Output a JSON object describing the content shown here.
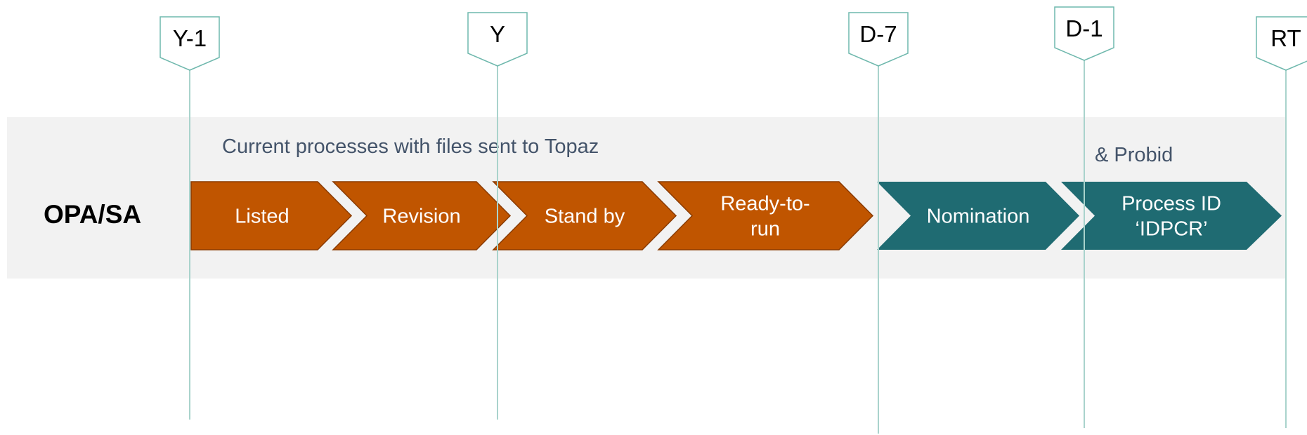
{
  "colors": {
    "band": "#f2f2f2",
    "orange": "#c05500",
    "orange_stroke": "#8a3b00",
    "teal": "#1f6b72",
    "marker_line": "#a9d3cc",
    "marker_box_stroke": "#6fb8ad",
    "caption_text": "#44546a"
  },
  "markers": [
    {
      "id": "y-minus-1",
      "label": "Y-1"
    },
    {
      "id": "y",
      "label": "Y"
    },
    {
      "id": "d-minus-7",
      "label": "D-7"
    },
    {
      "id": "d-minus-1",
      "label": "D-1"
    },
    {
      "id": "rt",
      "label": "RT"
    }
  ],
  "band": {
    "caption": "Current processes with files sent to Topaz",
    "caption_secondary": "& Probid"
  },
  "row": {
    "label": "OPA/SA"
  },
  "steps": [
    {
      "id": "listed",
      "lines": [
        "Listed"
      ],
      "color": "orange"
    },
    {
      "id": "revision",
      "lines": [
        "Revision"
      ],
      "color": "orange"
    },
    {
      "id": "stand-by",
      "lines": [
        "Stand by"
      ],
      "color": "orange"
    },
    {
      "id": "ready-to-run",
      "lines": [
        "Ready-to-",
        "run"
      ],
      "color": "orange"
    },
    {
      "id": "nomination",
      "lines": [
        "Nomination"
      ],
      "color": "teal"
    },
    {
      "id": "process-id",
      "lines": [
        "Process ID",
        "‘IDPCR’"
      ],
      "color": "teal"
    }
  ]
}
